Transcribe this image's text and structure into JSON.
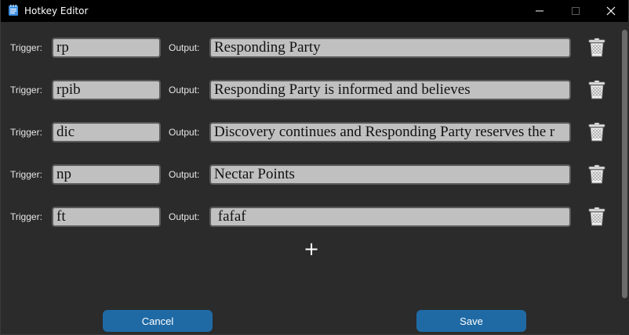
{
  "window": {
    "title": "Hotkey Editor",
    "icons": {
      "app": "notepad-icon",
      "minimize": "minimize-icon",
      "maximize": "maximize-icon",
      "close": "close-icon"
    }
  },
  "labels": {
    "trigger": "Trigger:",
    "output": "Output:"
  },
  "hotkeys": [
    {
      "trigger": "rp",
      "output": "Responding Party"
    },
    {
      "trigger": "rpib",
      "output": "Responding Party is informed and believes"
    },
    {
      "trigger": "dic",
      "output": "Discovery continues and Responding Party reserves the r"
    },
    {
      "trigger": "np",
      "output": "Nectar Points"
    },
    {
      "trigger": "ft",
      "output": " fafaf"
    }
  ],
  "row_icon": "trash-can-icon",
  "add_button": {
    "label": "+",
    "icon": "plus-icon"
  },
  "buttons": {
    "cancel": "Cancel",
    "save": "Save"
  },
  "colors": {
    "background": "#2b2b2b",
    "titlebar": "#000000",
    "field_bg": "#c0c0c0",
    "button": "#1f6aa5"
  }
}
